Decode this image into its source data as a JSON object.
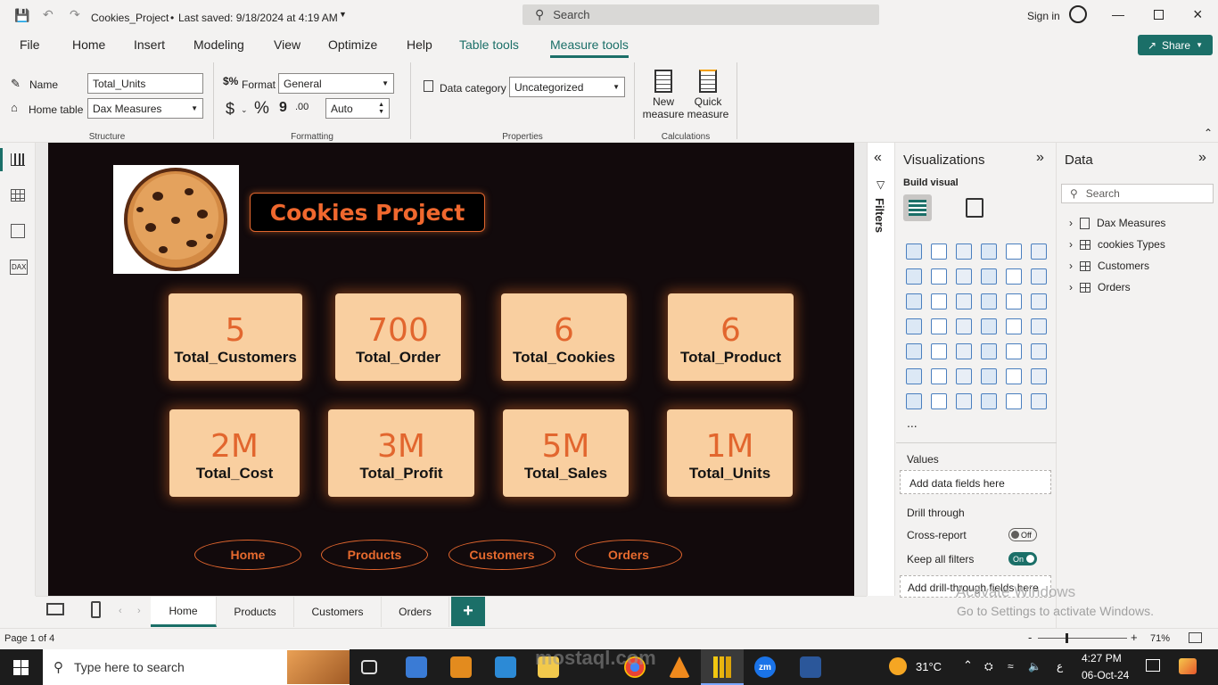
{
  "titlebar": {
    "file_title": "Cookies_Project",
    "saved_status": "Last saved: 9/18/2024 at 4:19 AM",
    "search_placeholder": "Search",
    "sign_in": "Sign in"
  },
  "ribbon_tabs": [
    {
      "label": "File"
    },
    {
      "label": "Home"
    },
    {
      "label": "Insert"
    },
    {
      "label": "Modeling"
    },
    {
      "label": "View"
    },
    {
      "label": "Optimize"
    },
    {
      "label": "Help"
    },
    {
      "label": "Table tools"
    },
    {
      "label": "Measure tools"
    }
  ],
  "share_label": "Share",
  "ribbon": {
    "name_label": "Name",
    "name_value": "Total_Units",
    "home_table_label": "Home table",
    "home_table_value": "Dax Measures",
    "structure_group": "Structure",
    "format_label": "Format",
    "format_value": "General",
    "currency_symbol": "$",
    "percent_symbol": "%",
    "comma_symbol": "9",
    "decimal_symbol": ".00",
    "auto_value": "Auto",
    "formatting_group": "Formatting",
    "data_category_label": "Data category",
    "data_category_value": "Uncategorized",
    "properties_group": "Properties",
    "new_measure_line1": "New",
    "new_measure_line2": "measure",
    "quick_measure_line1": "Quick",
    "quick_measure_line2": "measure",
    "calculations_group": "Calculations"
  },
  "report": {
    "title": "Cookies Project",
    "cards": [
      {
        "value": "5",
        "label": "Total_Customers"
      },
      {
        "value": "700",
        "label": "Total_Order"
      },
      {
        "value": "6",
        "label": "Total_Cookies"
      },
      {
        "value": "6",
        "label": "Total_Product"
      },
      {
        "value": "2M",
        "label": "Total_Cost"
      },
      {
        "value": "3M",
        "label": "Total_Profit"
      },
      {
        "value": "5M",
        "label": "Total_Sales"
      },
      {
        "value": "1M",
        "label": "Total_Units"
      }
    ],
    "nav_buttons": [
      {
        "label": "Home"
      },
      {
        "label": "Products"
      },
      {
        "label": "Customers"
      },
      {
        "label": "Orders"
      }
    ]
  },
  "filters_label": "Filters",
  "visualizations": {
    "title": "Visualizations",
    "build_visual": "Build visual",
    "more": "...",
    "values_label": "Values",
    "values_placeholder": "Add data fields here",
    "drill_through": "Drill through",
    "cross_report": "Cross-report",
    "cross_report_state": "Off",
    "keep_all_filters": "Keep all filters",
    "keep_all_filters_state": "On",
    "drill_placeholder": "Add drill-through fields here"
  },
  "data_pane": {
    "title": "Data",
    "search_placeholder": "Search",
    "tables": [
      {
        "name": "Dax Measures"
      },
      {
        "name": "cookies Types"
      },
      {
        "name": "Customers"
      },
      {
        "name": "Orders"
      }
    ]
  },
  "page_tabs": [
    {
      "label": "Home"
    },
    {
      "label": "Products"
    },
    {
      "label": "Customers"
    },
    {
      "label": "Orders"
    }
  ],
  "add_page": "+",
  "status": {
    "page": "Page 1 of 4",
    "zoom": "71%",
    "zoom_minus": "-",
    "zoom_plus": "+"
  },
  "watermark": {
    "line1": "Activate Windows",
    "line2": "Go to Settings to activate Windows.",
    "brand": "mostaql.com"
  },
  "taskbar": {
    "search_placeholder": "Type here to search",
    "weather": "31°C",
    "time": "4:27 PM",
    "date": "06-Oct-24",
    "lang": "ع",
    "zm": "zm"
  },
  "colors": {
    "accent": "#1b6f68",
    "card_bg": "#f9cfa0",
    "card_value": "#e2662e",
    "canvas_bg": "#120a0c"
  }
}
